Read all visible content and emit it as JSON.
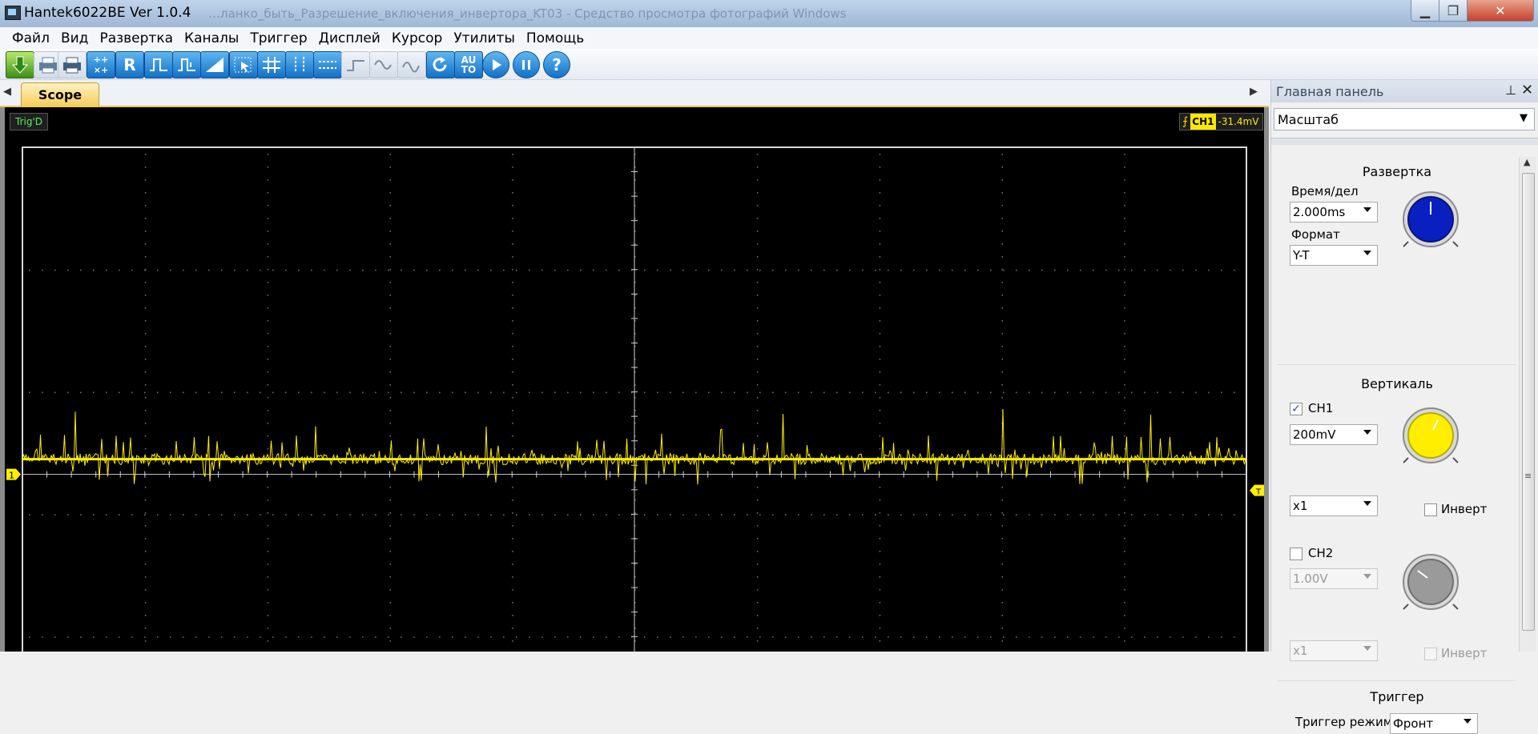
{
  "window": {
    "title": "Hantek6022BE Ver 1.0.4",
    "background_title": "…ланко_быть_Разрешение_включения_инвертора_KT03 - Средство просмотра фотографий Windows"
  },
  "menu": [
    "Файл",
    "Вид",
    "Развертка",
    "Каналы",
    "Триггер",
    "Дисплей",
    "Курсор",
    "Утилиты",
    "Помощь"
  ],
  "toolbar": {
    "icons": [
      "save-green-icon",
      "print-icon",
      "print-preview-icon",
      "math-icon",
      "reference-icon",
      "pulse-icon",
      "pulse-2-icon",
      "ramp-icon",
      "cursor-select-icon",
      "grid-icon",
      "cursor-v-icon",
      "cursor-h-icon",
      "step-icon",
      "sine-icon",
      "sine-2-icon",
      "reset-icon",
      "auto-icon",
      "run-icon",
      "pause-icon",
      "help-icon"
    ],
    "r_label": "R",
    "auto_label": "AU TO",
    "help_label": "?"
  },
  "tabs": {
    "scope_label": "Scope",
    "left_arrow": "◀",
    "right_arrow": "▶"
  },
  "scope": {
    "status_trig": "Trig'D",
    "ch_label": "CH1",
    "ch_value": "-31.4mV",
    "ch1_marker": "1",
    "trigger_marker": "T",
    "trace_color": "#ffee00"
  },
  "panel": {
    "title": "Главная панель",
    "pin_icon": "pin-icon",
    "close_label": "✕",
    "mode_select": "Масштаб",
    "timebase": {
      "section_title": "Развертка",
      "time_label": "Время/дел",
      "time_value": "2.000ms",
      "format_label": "Формат",
      "format_value": "Y-T",
      "knob_color": "#0a1fbf"
    },
    "vertical": {
      "section_title": "Вертикаль",
      "ch1_label": "CH1",
      "ch1_checked": true,
      "ch1_volts": "200mV",
      "ch1_probe": "x1",
      "ch1_invert_label": "Инверт",
      "ch1_knob_color": "#ffee00",
      "ch2_label": "CH2",
      "ch2_checked": false,
      "ch2_volts": "1.00V",
      "ch2_probe": "x1",
      "ch2_invert_label": "Инверт",
      "ch2_knob_color": "#9a9a9a"
    },
    "trigger": {
      "section_title": "Триггер",
      "mode_label": "Триггер режим",
      "mode_value": "Фронт"
    }
  }
}
